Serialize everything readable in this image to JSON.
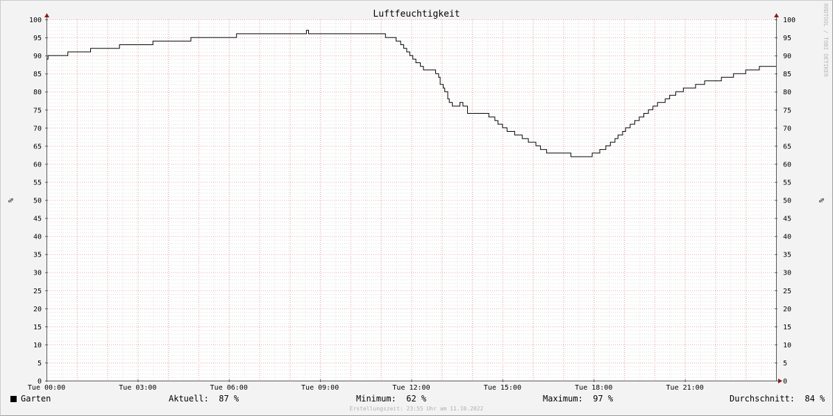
{
  "chart_data": {
    "type": "line",
    "title": "Luftfeuchtigkeit",
    "ylabel": "%",
    "ylabel_right": "%",
    "ylim": [
      0,
      100
    ],
    "yticks": [
      0,
      5,
      10,
      15,
      20,
      25,
      30,
      35,
      40,
      45,
      50,
      55,
      60,
      65,
      70,
      75,
      80,
      85,
      90,
      95,
      100
    ],
    "xlim_hours": [
      0,
      24
    ],
    "xticks": [
      {
        "hour": 0,
        "label": "Tue 00:00"
      },
      {
        "hour": 3,
        "label": "Tue 03:00"
      },
      {
        "hour": 6,
        "label": "Tue 06:00"
      },
      {
        "hour": 9,
        "label": "Tue 09:00"
      },
      {
        "hour": 12,
        "label": "Tue 12:00"
      },
      {
        "hour": 15,
        "label": "Tue 15:00"
      },
      {
        "hour": 18,
        "label": "Tue 18:00"
      },
      {
        "hour": 21,
        "label": "Tue 21:00"
      }
    ],
    "grid": true,
    "legend_position": "bottom-left",
    "series": [
      {
        "name": "Garten",
        "color": "#000000",
        "step": true,
        "points": [
          [
            0.0,
            89
          ],
          [
            0.05,
            90
          ],
          [
            0.7,
            91
          ],
          [
            1.45,
            92
          ],
          [
            2.4,
            93
          ],
          [
            3.5,
            94
          ],
          [
            4.75,
            95
          ],
          [
            6.25,
            96
          ],
          [
            8.55,
            97
          ],
          [
            8.62,
            96
          ],
          [
            11.15,
            95
          ],
          [
            11.5,
            94
          ],
          [
            11.65,
            93
          ],
          [
            11.75,
            92
          ],
          [
            11.85,
            91
          ],
          [
            11.95,
            90
          ],
          [
            12.05,
            89
          ],
          [
            12.15,
            88
          ],
          [
            12.3,
            87
          ],
          [
            12.4,
            86
          ],
          [
            12.8,
            85
          ],
          [
            12.9,
            84
          ],
          [
            12.95,
            82
          ],
          [
            13.05,
            81
          ],
          [
            13.1,
            80
          ],
          [
            13.2,
            78
          ],
          [
            13.25,
            77
          ],
          [
            13.35,
            76
          ],
          [
            13.6,
            77
          ],
          [
            13.7,
            76
          ],
          [
            13.85,
            74
          ],
          [
            14.55,
            73
          ],
          [
            14.75,
            72
          ],
          [
            14.85,
            71
          ],
          [
            15.0,
            70
          ],
          [
            15.15,
            69
          ],
          [
            15.4,
            68
          ],
          [
            15.65,
            67
          ],
          [
            15.85,
            66
          ],
          [
            16.1,
            65
          ],
          [
            16.25,
            64
          ],
          [
            16.45,
            63
          ],
          [
            17.25,
            62
          ],
          [
            17.95,
            63
          ],
          [
            18.2,
            64
          ],
          [
            18.4,
            65
          ],
          [
            18.55,
            66
          ],
          [
            18.7,
            67
          ],
          [
            18.8,
            68
          ],
          [
            18.95,
            69
          ],
          [
            19.05,
            70
          ],
          [
            19.2,
            71
          ],
          [
            19.35,
            72
          ],
          [
            19.5,
            73
          ],
          [
            19.65,
            74
          ],
          [
            19.8,
            75
          ],
          [
            19.95,
            76
          ],
          [
            20.1,
            77
          ],
          [
            20.35,
            78
          ],
          [
            20.5,
            79
          ],
          [
            20.7,
            80
          ],
          [
            20.95,
            81
          ],
          [
            21.35,
            82
          ],
          [
            21.65,
            83
          ],
          [
            22.2,
            84
          ],
          [
            22.6,
            85
          ],
          [
            23.0,
            86
          ],
          [
            23.45,
            87
          ],
          [
            24.0,
            87
          ]
        ]
      }
    ]
  },
  "legend": {
    "series_name": "Garten",
    "current_label": "Aktuell:",
    "current_value": "87 %",
    "min_label": "Minimum:",
    "min_value": "62 %",
    "max_label": "Maximum:",
    "max_value": "97 %",
    "avg_label": "Durchschnitt:",
    "avg_value": "84 %"
  },
  "watermark": "RRDTOOL / TOBI OETIKER",
  "footer": "Erstellungszeit: 23:55 Uhr am 11.10.2022"
}
